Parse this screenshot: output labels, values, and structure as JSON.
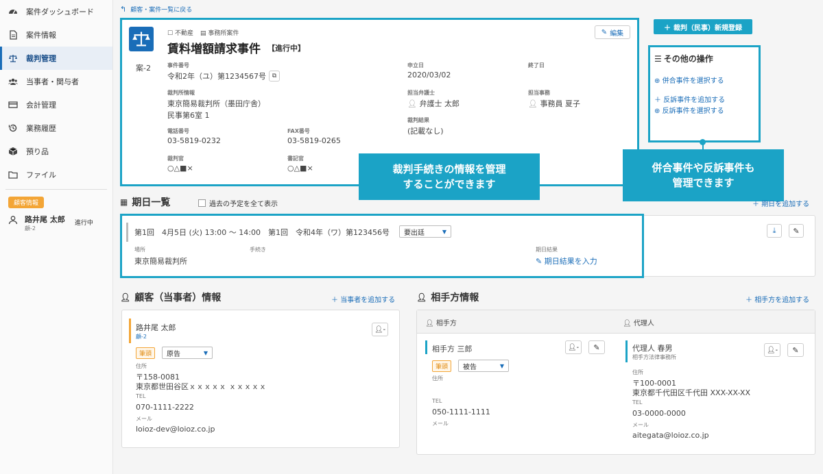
{
  "sidebar": {
    "items": [
      {
        "label": "案件ダッシュボード",
        "icon": "dashboard-icon"
      },
      {
        "label": "案件情報",
        "icon": "document-icon"
      },
      {
        "label": "裁判管理",
        "icon": "scale-icon",
        "active": true
      },
      {
        "label": "当事者・関与者",
        "icon": "people-icon"
      },
      {
        "label": "会計管理",
        "icon": "card-icon"
      },
      {
        "label": "業務履歴",
        "icon": "history-icon"
      },
      {
        "label": "預り品",
        "icon": "box-icon"
      },
      {
        "label": "ファイル",
        "icon": "folder-icon"
      }
    ],
    "client_badge": "顧客情報",
    "client_name": "路井尾 太郎",
    "client_id": "顧-2",
    "client_status": "進行中"
  },
  "back_link": "顧客・案件一覧に戻る",
  "case": {
    "tag1": "不動産",
    "tag2": "事務所案件",
    "title": "賃料増額請求事件",
    "status": "【進行中】",
    "case_id": "案-2",
    "edit_label": "編集",
    "number_label": "事件番号",
    "number_value": "令和2年（ユ）第1234567号",
    "start_label": "申立日",
    "start_value": "2020/03/02",
    "end_label": "終了日",
    "court_label": "裁判所情報",
    "court_line1": "東京簡易裁判所（墨田庁舎）",
    "court_line2": "民事第6室 1",
    "lawyer_label": "担当弁護士",
    "lawyer_value": "弁護士 太郎",
    "clerk_label": "担当事務",
    "clerk_value": "事務員 夏子",
    "result_label": "裁判結果",
    "result_value": "(記載なし)",
    "tel_label": "電話番号",
    "tel_value": "03-5819-0232",
    "fax_label": "FAX番号",
    "fax_value": "03-5819-0265",
    "judge_label": "裁判官",
    "judge_value": "○△■×",
    "secretary_label": "書記官",
    "secretary_value": "○△■×"
  },
  "new_trial_button": "裁判（民事）新規登録",
  "other_ops": {
    "title": "その他の操作",
    "op1": "併合事件を選択する",
    "op2": "反訴事件を追加する",
    "op3": "反訴事件を選択する"
  },
  "callout_left": {
    "line1": "裁判手続きの情報を管理",
    "line2": "することができます"
  },
  "callout_right": {
    "line1": "併合事件や反訴事件も",
    "line2": "管理できます"
  },
  "schedule": {
    "title": "期日一覧",
    "show_past": "過去の予定を全て表示",
    "add_label": "期日を追加する",
    "row_text": "第1回　4月5日 (火) 13:00 ～ 14:00　第1回　令和4年（ワ）第123456号",
    "attendance": "要出廷",
    "place_label": "場所",
    "place_value": "東京簡易裁判所",
    "procedure_label": "手続き",
    "result_label": "期日結果",
    "result_link": "期日結果を入力"
  },
  "client_section": {
    "title": "顧客（当事者）情報",
    "add_label": "当事者を追加する",
    "name": "路井尾 太郎",
    "id": "顧-2",
    "tag": "筆頭",
    "role": "原告",
    "address_label": "住所",
    "zip": "〒158-0081",
    "address": "東京都世田谷区ｘｘｘｘｘ ｘｘｘｘｘ",
    "tel_label": "TEL",
    "tel": "070-1111-2222",
    "mail_label": "メール",
    "mail": "loioz-dev@loioz.co.jp"
  },
  "opponent_section": {
    "title": "相手方情報",
    "add_label": "相手方を追加する",
    "col1_header": "相手方",
    "col2_header": "代理人",
    "opp_name": "相手方 三郎",
    "opp_tag": "筆頭",
    "opp_role": "被告",
    "opp_address_label": "住所",
    "opp_tel_label": "TEL",
    "opp_tel": "050-1111-1111",
    "opp_mail_label": "メール",
    "agent_name": "代理人 春男",
    "agent_firm": "相手方法律事務所",
    "agent_address_label": "住所",
    "agent_zip": "〒100-0001",
    "agent_address": "東京都千代田区千代田 XXX-XX-XX",
    "agent_tel_label": "TEL",
    "agent_tel": "03-0000-0000",
    "agent_mail_label": "メール",
    "agent_mail": "aitegata@loioz.co.jp"
  }
}
